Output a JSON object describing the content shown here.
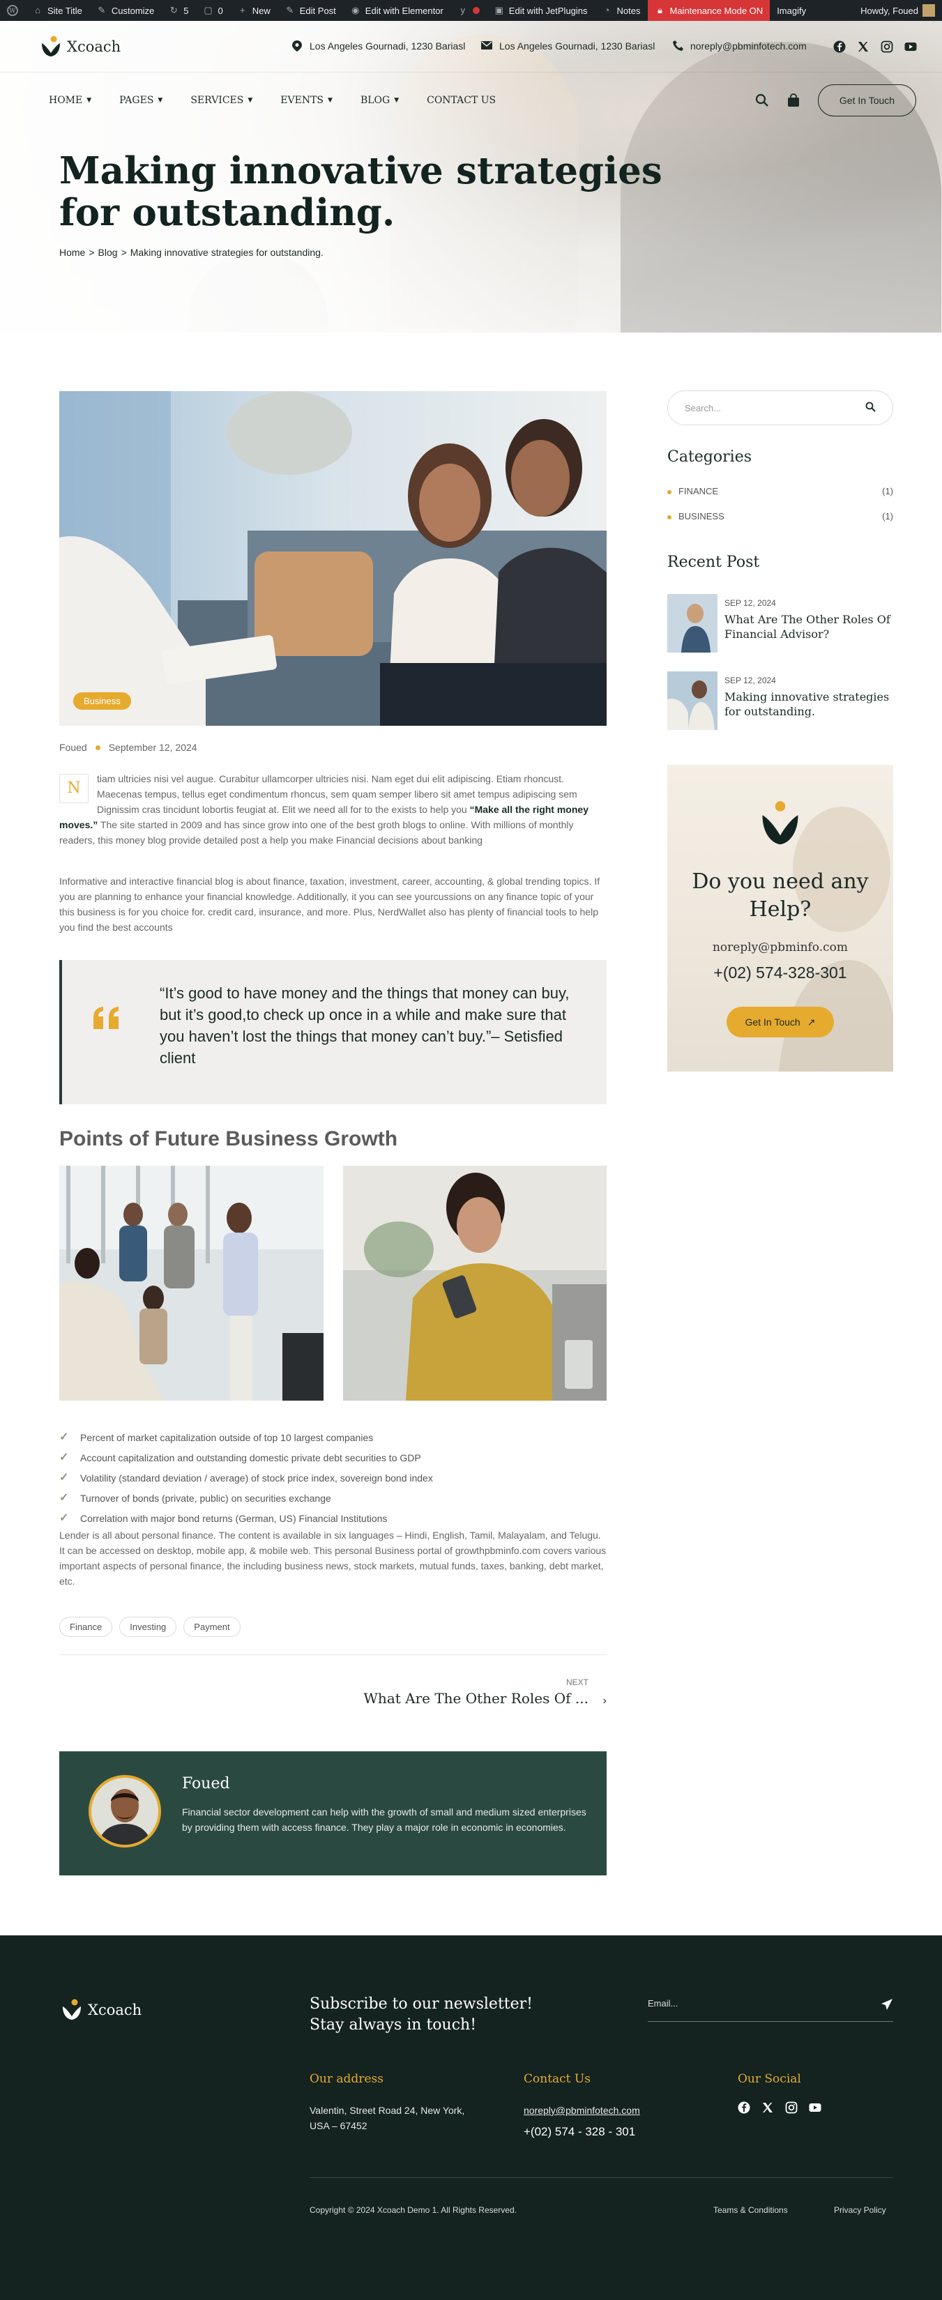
{
  "adminbar": {
    "site_title": "Site Title",
    "customize": "Customize",
    "updates": "5",
    "comments": "0",
    "new": "New",
    "edit_post": "Edit Post",
    "edit_elementor": "Edit with Elementor",
    "edit_jet": "Edit with JetPlugins",
    "notes": "Notes",
    "maintenance": "Maintenance Mode ON",
    "imagify": "Imagify",
    "howdy": "Howdy, Foued"
  },
  "header": {
    "logo": "Xcoach",
    "address1": "Los Angeles Gournadi, 1230 Bariasl",
    "address2": "Los Angeles Gournadi, 1230 Bariasl",
    "email": "noreply@pbminfotech.com",
    "nav": [
      "HOME",
      "PAGES",
      "SERVICES",
      "EVENTS",
      "BLOG",
      "CONTACT US"
    ],
    "cta": "Get In Touch"
  },
  "hero": {
    "title": "Making innovative strategies for outstanding.",
    "crumb_home": "Home",
    "crumb_sep": ">",
    "crumb_blog": "Blog",
    "crumb_current": "Making innovative strategies for outstanding."
  },
  "post": {
    "category": "Business",
    "author": "Foued",
    "date": "September 12, 2024",
    "dropcap": "N",
    "p1_a": "tiam ultricies nisi vel augue. Curabitur ullamcorper ultricies nisi. Nam eget dui elit adipiscing. Etiam rhoncust. Maecenas tempus, tellus eget condimentum rhoncus, sem quam semper libero sit amet tempus adipiscing sem Dignissim cras tincidunt lobortis feugiat at. Elit we need all for to the exists to help you ",
    "p1_strong": "“Make all the right money moves.”",
    "p1_b": " The site started in 2009 and has since grow into one of the best groth blogs to online. With millions of monthly readers, this money blog provide detailed post a help you make Financial decisions about banking",
    "p2": "Informative and interactive financial blog is about finance, taxation, investment, career, accounting, & global trending topics. If you are planning to enhance your financial knowledge. Additionally, it you can see yourcussions on any finance topic of your this business is for you choice for. credit card, insurance, and more. Plus, NerdWallet also has plenty of financial tools to help you find the best accounts",
    "quote": "“It’s good to have money and the things that money can buy, but it’s good,to check up once in a while and make sure that you haven’t lost the things that money can’t buy.”– Setisfied client",
    "section_title": "Points of Future Business Growth",
    "list": [
      "Percent of market capitalization outside of top 10 largest companies",
      "Account capitalization and outstanding domestic private debt securities to GDP",
      "Volatility (standard deviation / average) of stock price index, sovereign bond index",
      "Turnover of bonds (private, public) on securities exchange",
      "Correlation with major bond returns (German, US) Financial Institutions"
    ],
    "p3": "Lender is all about personal finance. The content is available in six languages – Hindi, English, Tamil, Malayalam, and Telugu. It can be accessed on desktop, mobile app, & mobile web. This personal Business portal of growthpbminfo.com covers various important aspects of personal finance, the including business news, stock markets, mutual funds, taxes, banking, debt market, etc.",
    "tags": [
      "Finance",
      "Investing",
      "Payment"
    ],
    "next_label": "NEXT",
    "next_title": "What Are The Other Roles Of ...",
    "author_name": "Foued",
    "author_bio": "Financial sector development can help with the growth of small and medium sized enterprises by providing them with access finance. They play a major role in economic in economies."
  },
  "sidebar": {
    "search_placeholder": "Search...",
    "categories_title": "Categories",
    "categories": [
      {
        "name": "FINANCE",
        "count": "(1)"
      },
      {
        "name": "BUSINESS",
        "count": "(1)"
      }
    ],
    "recent_title": "Recent Post",
    "recent": [
      {
        "date": "SEP 12, 2024",
        "title": "What Are The Other Roles Of Financial Advisor?"
      },
      {
        "date": "SEP 12, 2024",
        "title": "Making innovative strategies for outstanding."
      }
    ],
    "help_title": "Do you need any Help?",
    "help_email": "noreply@pbminfo.com",
    "help_phone": "+(02) 574-328-301",
    "help_btn": "Get In Touch"
  },
  "footer": {
    "logo": "Xcoach",
    "newsletter": "Subscribe to our newsletter! Stay always in touch!",
    "email_placeholder": "Email...",
    "address_title": "Our address",
    "address": "Valentin, Street Road 24, New York, USA – 67452",
    "contact_title": "Contact Us",
    "contact_email": "noreply@pbminfotech.com",
    "contact_phone": "+(02) 574 - 328 - 301",
    "social_title": "Our Social",
    "copyright": "Copyright © 2024 Xcoach Demo 1. All Rights Reserved.",
    "terms": "Teams & Conditions",
    "privacy": "Privacy Policy"
  },
  "colors": {
    "accent": "#e6aa2e",
    "dark": "#142320",
    "author_bg": "#2a4a41",
    "maintenance": "#d63638"
  }
}
